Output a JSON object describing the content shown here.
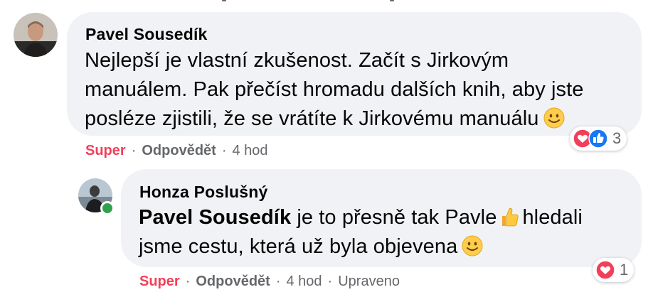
{
  "comment": {
    "author": "Pavel Sousedík",
    "text_line1": "Nejlepší je vlastní zkušenost. Začít s Jirkovým",
    "text_line2": "manuálem. Pak přečíst hromadu dalších knih, aby jste",
    "text_line3": "posléze zjistili, že se vrátíte k Jirkovému manuálu",
    "reaction_label": "Super",
    "reply_label": "Odpovědět",
    "time": "4 hod",
    "reaction_count": "3",
    "reaction_icons": [
      "heart-icon",
      "like-icon"
    ]
  },
  "reply": {
    "author": "Honza Poslušný",
    "mention": "Pavel Sousedík",
    "text_part1": "je to přesně tak Pavle",
    "text_part2": "hledali",
    "text_line2": "jsme cestu, která už byla objevena",
    "reaction_label": "Super",
    "reply_label": "Odpovědět",
    "time": "4 hod",
    "edited_label": "Upraveno",
    "reaction_count": "1",
    "reaction_icons": [
      "heart-icon"
    ],
    "online": true
  },
  "colors": {
    "bubble": "#f0f2f5",
    "super": "#f33e58",
    "meta": "#65676b",
    "like_blue": "#1877f2",
    "online_green": "#31a24c"
  }
}
